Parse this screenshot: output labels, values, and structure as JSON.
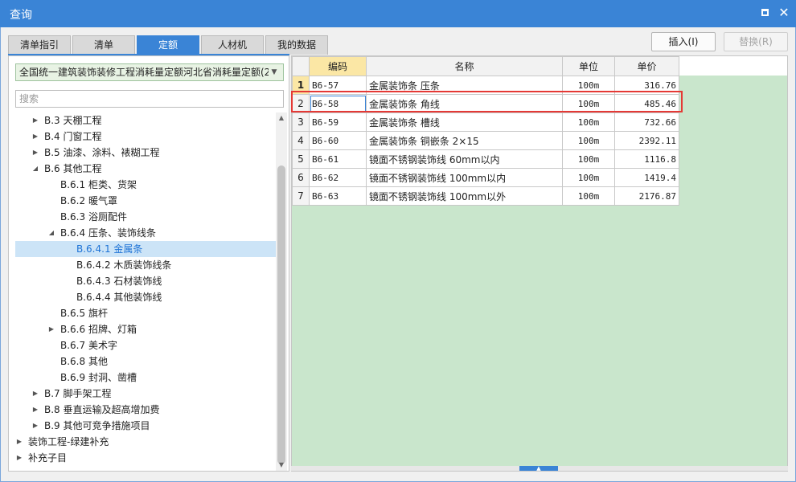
{
  "window": {
    "title": "查询"
  },
  "tabs": [
    {
      "label": "清单指引",
      "active": false
    },
    {
      "label": "清单",
      "active": false
    },
    {
      "label": "定额",
      "active": true
    },
    {
      "label": "人材机",
      "active": false
    },
    {
      "label": "我的数据",
      "active": false
    }
  ],
  "library": {
    "selected": "全国统一建筑装饰装修工程消耗量定额河北省消耗量定额(20"
  },
  "search": {
    "placeholder": "搜索"
  },
  "tree": [
    {
      "label": "B.3 天棚工程",
      "level": 2,
      "toggle": "collapsed"
    },
    {
      "label": "B.4 门窗工程",
      "level": 2,
      "toggle": "collapsed"
    },
    {
      "label": "B.5 油漆、涂料、裱糊工程",
      "level": 2,
      "toggle": "collapsed"
    },
    {
      "label": "B.6 其他工程",
      "level": 2,
      "toggle": "expanded"
    },
    {
      "label": "B.6.1 柜类、货架",
      "level": 3,
      "toggle": "none"
    },
    {
      "label": "B.6.2 暖气罩",
      "level": 3,
      "toggle": "none"
    },
    {
      "label": "B.6.3 浴厕配件",
      "level": 3,
      "toggle": "none"
    },
    {
      "label": "B.6.4 压条、装饰线条",
      "level": 3,
      "toggle": "expanded"
    },
    {
      "label": "B.6.4.1 金属条",
      "level": 4,
      "toggle": "none",
      "selected": true
    },
    {
      "label": "B.6.4.2 木质装饰线条",
      "level": 4,
      "toggle": "none"
    },
    {
      "label": "B.6.4.3 石材装饰线",
      "level": 4,
      "toggle": "none"
    },
    {
      "label": "B.6.4.4 其他装饰线",
      "level": 4,
      "toggle": "none"
    },
    {
      "label": "B.6.5 旗杆",
      "level": 3,
      "toggle": "none"
    },
    {
      "label": "B.6.6 招牌、灯箱",
      "level": 3,
      "toggle": "collapsed"
    },
    {
      "label": "B.6.7 美术字",
      "level": 3,
      "toggle": "none"
    },
    {
      "label": "B.6.8 其他",
      "level": 3,
      "toggle": "none"
    },
    {
      "label": "B.6.9 封洞、凿槽",
      "level": 3,
      "toggle": "none"
    },
    {
      "label": "B.7 脚手架工程",
      "level": 2,
      "toggle": "collapsed"
    },
    {
      "label": "B.8 垂直运输及超高增加费",
      "level": 2,
      "toggle": "collapsed"
    },
    {
      "label": "B.9 其他可竞争措施项目",
      "level": 2,
      "toggle": "collapsed"
    },
    {
      "label": "装饰工程-绿建补充",
      "level": 1,
      "toggle": "collapsed"
    },
    {
      "label": "补充子目",
      "level": 1,
      "toggle": "collapsed"
    }
  ],
  "actions": {
    "insert_label": "插入(I)",
    "replace_label": "替换(R)"
  },
  "grid": {
    "columns": [
      "编码",
      "名称",
      "单位",
      "单价"
    ],
    "rows": [
      {
        "no": "1",
        "code": "B6-57",
        "name": "金属装饰条 压条",
        "unit": "100m",
        "price": "316.76"
      },
      {
        "no": "2",
        "code": "B6-58",
        "name": "金属装饰条 角线",
        "unit": "100m",
        "price": "485.46"
      },
      {
        "no": "3",
        "code": "B6-59",
        "name": "金属装饰条 槽线",
        "unit": "100m",
        "price": "732.66"
      },
      {
        "no": "4",
        "code": "B6-60",
        "name": "金属装饰条 铜嵌条 2×15",
        "unit": "100m",
        "price": "2392.11"
      },
      {
        "no": "5",
        "code": "B6-61",
        "name": "镜面不锈钢装饰线 60mm以内",
        "unit": "100m",
        "price": "1116.8"
      },
      {
        "no": "6",
        "code": "B6-62",
        "name": "镜面不锈钢装饰线 100mm以内",
        "unit": "100m",
        "price": "1419.4"
      },
      {
        "no": "7",
        "code": "B6-63",
        "name": "镜面不锈钢装饰线 100mm以外",
        "unit": "100m",
        "price": "2176.87"
      }
    ]
  },
  "colors": {
    "accent": "#3a84d6",
    "highlight": "#e53935",
    "grid_bg": "#c9e6cc",
    "header_selected": "#fbe7a5"
  },
  "icons": {
    "maximize": "maximize-icon",
    "close": "close-icon",
    "expand": "triangle-right-icon",
    "collapse": "triangle-down-icon"
  }
}
